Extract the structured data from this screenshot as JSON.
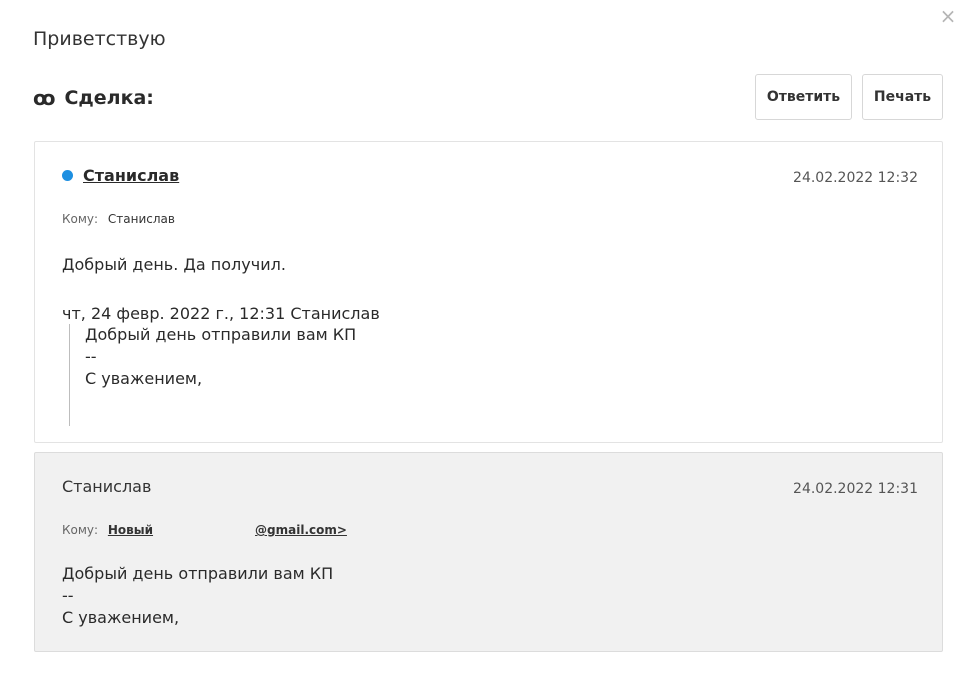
{
  "header": {
    "greeting": "Приветствую",
    "deal_label": "Сделка:",
    "deal_icon": "link-icon",
    "close_symbol": "×"
  },
  "toolbar": {
    "reply_label": "Ответить",
    "print_label": "Печать"
  },
  "messages": [
    {
      "sender": "Станислав",
      "date": "24.02.2022 12:32",
      "to_label": "Кому:",
      "to_value": "Станислав",
      "body": "Добрый день. Да получил.",
      "quote_header": "чт, 24 февр. 2022 г., 12:31 Станислав",
      "quote_lines": [
        "Добрый день отправили вам КП",
        "--",
        "С уважением,"
      ],
      "status_color": "#1d8fe1"
    },
    {
      "sender": "Станислав",
      "date": "24.02.2022 12:31",
      "to_label": "Кому:",
      "to_value_start": "Новый",
      "to_value_end": "@gmail.com>",
      "body_lines": [
        "Добрый день отправили вам КП",
        "--",
        "С уважением,"
      ]
    }
  ]
}
